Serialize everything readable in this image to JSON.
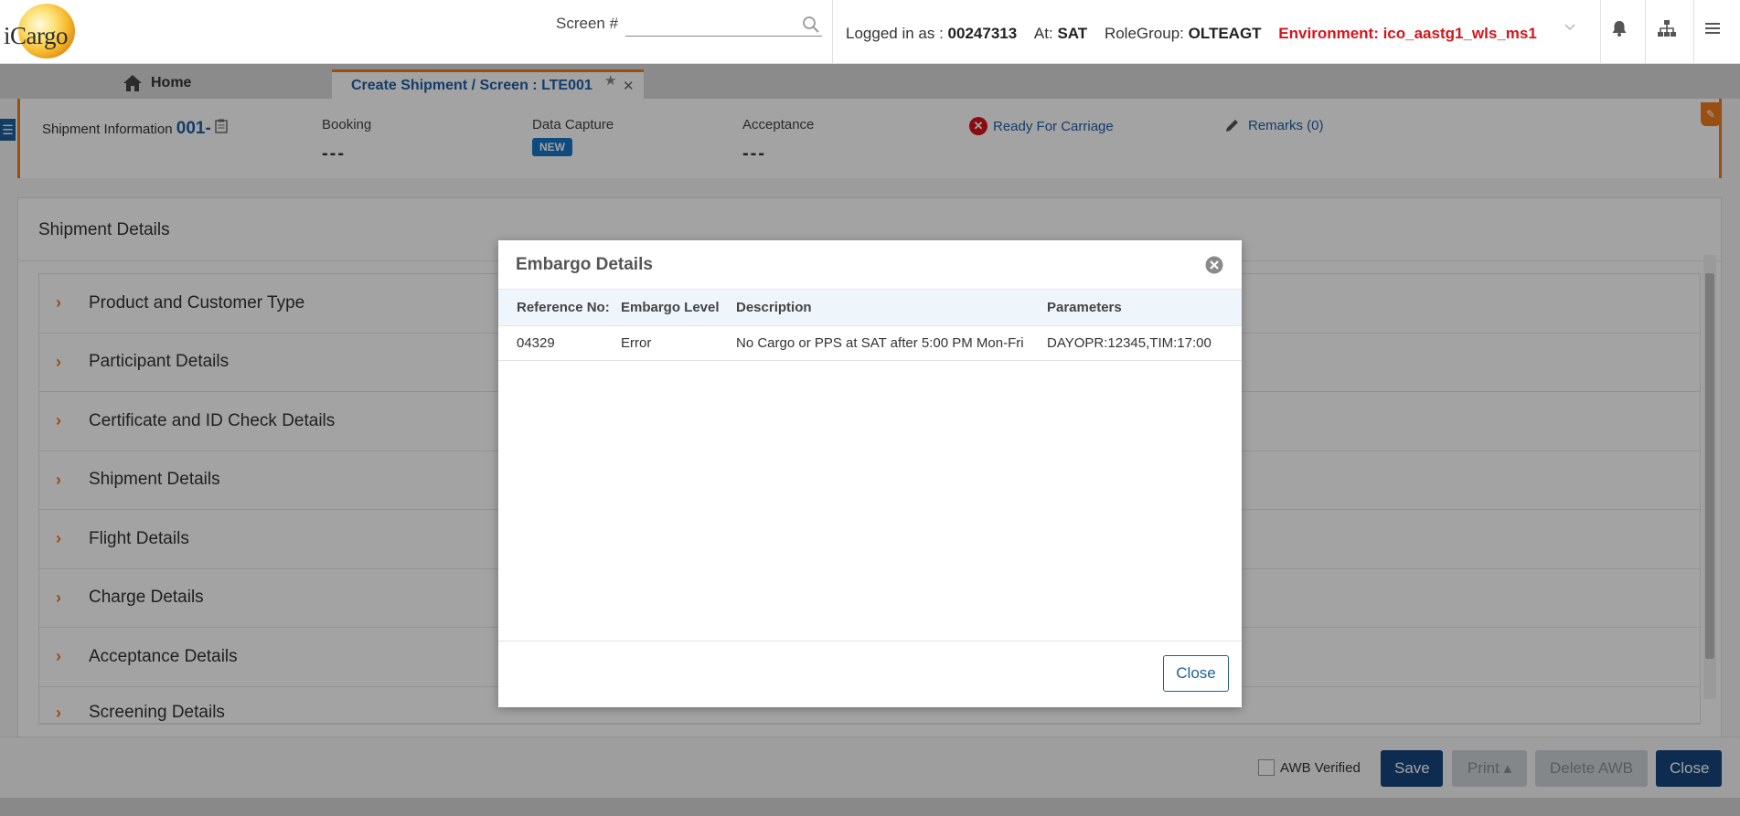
{
  "header": {
    "logo_text": "iCargo",
    "screen_label": "Screen #",
    "screen_input_value": "",
    "logged_in_label": "Logged in as :",
    "user_id": "00247313",
    "at_label": "At:",
    "station": "SAT",
    "rolegroup_label": "RoleGroup:",
    "rolegroup": "OLTEAGT",
    "environment": "Environment: ico_aastg1_wls_ms1"
  },
  "tabs": {
    "home": "Home",
    "active": "Create Shipment / Screen : LTE001"
  },
  "shipment_info": {
    "label": "Shipment Information",
    "number": "001-",
    "booking_label": "Booking",
    "booking_value": "---",
    "data_capture_label": "Data Capture",
    "data_capture_badge": "NEW",
    "acceptance_label": "Acceptance",
    "acceptance_value": "---",
    "ready_for_carriage": "Ready For Carriage",
    "remarks": "Remarks (0)"
  },
  "shipment_details": {
    "title": "Shipment Details",
    "sections": [
      "Product and Customer Type",
      "Participant Details",
      "Certificate and ID Check Details",
      "Shipment Details",
      "Flight Details",
      "Charge Details",
      "Acceptance Details",
      "Screening Details"
    ]
  },
  "footer": {
    "awb_verified": "AWB Verified",
    "save": "Save",
    "print": "Print",
    "delete_awb": "Delete AWB",
    "close": "Close"
  },
  "modal": {
    "title": "Embargo Details",
    "columns": [
      "Reference No:",
      "Embargo Level",
      "Description",
      "Parameters"
    ],
    "rows": [
      [
        "04329",
        "Error",
        "No Cargo or PPS at SAT after 5:00 PM Mon-Fri",
        "DAYOPR:12345,TIM:17:00"
      ]
    ],
    "close_button": "Close"
  },
  "colors": {
    "accent_orange": "#f07b1d",
    "primary_blue": "#15467d",
    "link_blue": "#1f5fa8",
    "env_red": "#d8141b"
  }
}
